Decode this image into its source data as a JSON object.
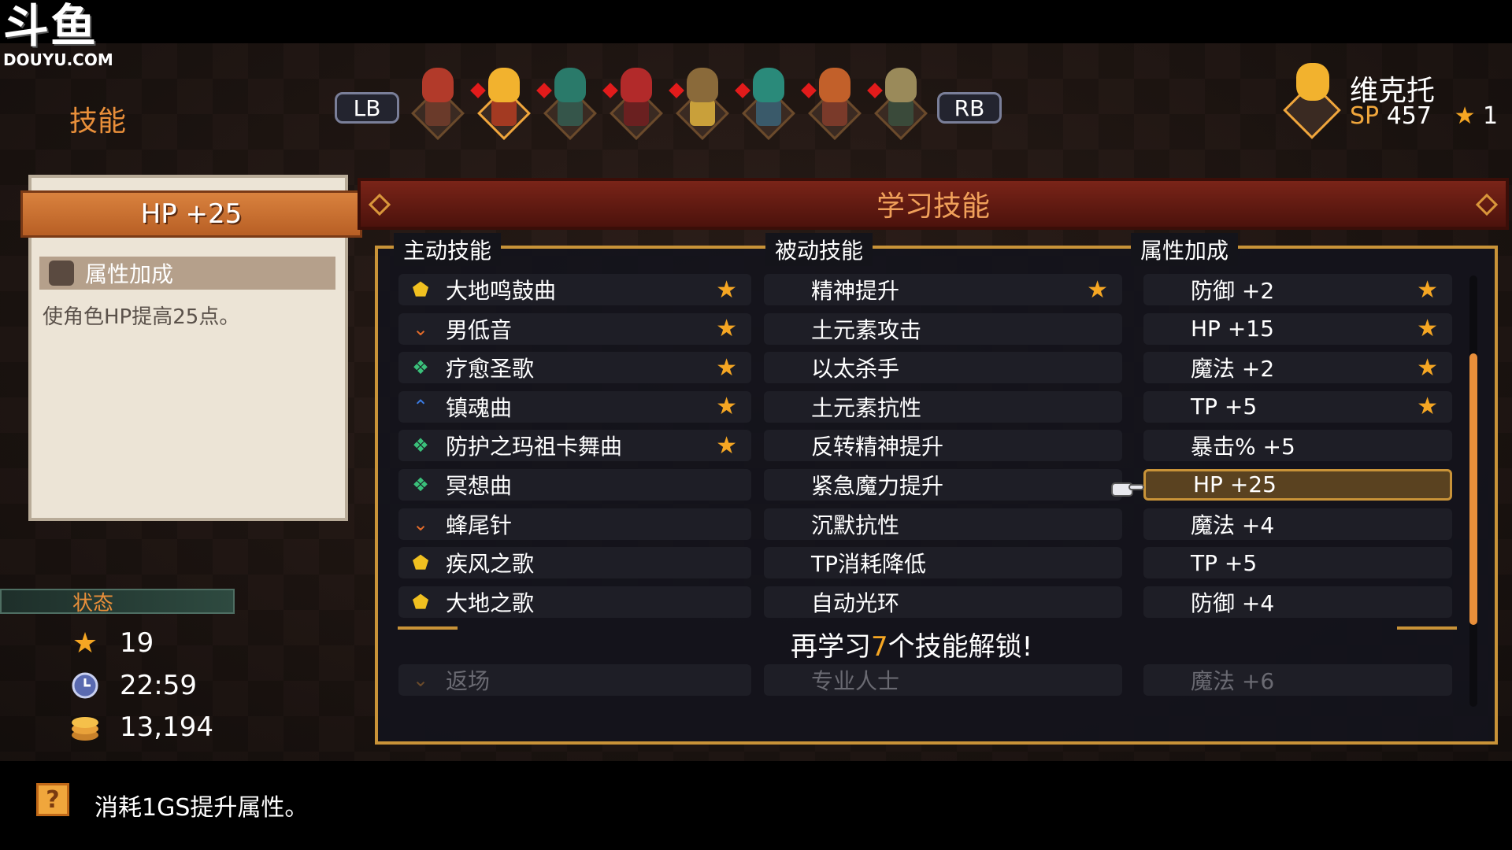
{
  "watermark": {
    "glyph": "斗鱼",
    "text": "DOUYU.COM"
  },
  "screen_title": "技能",
  "bumpers": {
    "left": "LB",
    "right": "RB"
  },
  "party": [
    {
      "head": "#b23a2a",
      "body": "#6a3a2a",
      "dot": false
    },
    {
      "head": "#f2b22e",
      "body": "#a33a22",
      "dot": true,
      "selected": true
    },
    {
      "head": "#2a7a6a",
      "body": "#35554a",
      "dot": true
    },
    {
      "head": "#b22a2a",
      "body": "#6a2020",
      "dot": true
    },
    {
      "head": "#8a6a3a",
      "body": "#c9a03a",
      "dot": true
    },
    {
      "head": "#2a8a7a",
      "body": "#3a5a6a",
      "dot": true
    },
    {
      "head": "#c2602a",
      "body": "#7a3a2a",
      "dot": true
    },
    {
      "head": "#9a8a5a",
      "body": "#3a4a3a",
      "dot": true
    }
  ],
  "character": {
    "name": "维克托",
    "sp_label": "SP",
    "sp_value": "457",
    "star_glyph": "★",
    "star_count": "1"
  },
  "info": {
    "title": "HP +25",
    "category": "属性加成",
    "description": "使角色HP提高25点。"
  },
  "status": {
    "header": "状态",
    "stars": "19",
    "time": "22:59",
    "gold": "13,194"
  },
  "skills_title": "学习技能",
  "columns": {
    "active": "主动技能",
    "passive": "被动技能",
    "attr": "属性加成"
  },
  "active_skills": [
    {
      "name": "大地鸣鼓曲",
      "icon": "yellow-shield-icon",
      "icon_glyph": "⬟",
      "color": "#f0c020",
      "learned": true
    },
    {
      "name": "男低音",
      "icon": "orange-chevron-icon",
      "icon_glyph": "⌄",
      "color": "#e06a2a",
      "learned": true
    },
    {
      "name": "疗愈圣歌",
      "icon": "green-heal-icon",
      "icon_glyph": "❖",
      "color": "#3ac07a",
      "learned": true
    },
    {
      "name": "镇魂曲",
      "icon": "blue-arrow-icon",
      "icon_glyph": "⌃",
      "color": "#3a7ae0",
      "learned": true
    },
    {
      "name": "防护之玛祖卡舞曲",
      "icon": "green-heal-icon",
      "icon_glyph": "❖",
      "color": "#3ac07a",
      "learned": true
    },
    {
      "name": "冥想曲",
      "icon": "green-heal-icon",
      "icon_glyph": "❖",
      "color": "#3ac07a",
      "learned": false
    },
    {
      "name": "蜂尾针",
      "icon": "orange-chevron-icon",
      "icon_glyph": "⌄",
      "color": "#e06a2a",
      "learned": false
    },
    {
      "name": "疾风之歌",
      "icon": "yellow-shield-icon",
      "icon_glyph": "⬟",
      "color": "#f0c020",
      "learned": false
    },
    {
      "name": "大地之歌",
      "icon": "yellow-shield-icon",
      "icon_glyph": "⬟",
      "color": "#f0c020",
      "learned": false
    }
  ],
  "passive_skills": [
    {
      "name": "精神提升",
      "learned": true
    },
    {
      "name": "土元素攻击",
      "learned": false
    },
    {
      "name": "以太杀手",
      "learned": false
    },
    {
      "name": "土元素抗性",
      "learned": false
    },
    {
      "name": "反转精神提升",
      "learned": false
    },
    {
      "name": "紧急魔力提升",
      "learned": false
    },
    {
      "name": "沉默抗性",
      "learned": false
    },
    {
      "name": "TP消耗降低",
      "learned": false
    },
    {
      "name": "自动光环",
      "learned": false
    }
  ],
  "attr_skills": [
    {
      "name": "防御 +2",
      "learned": true
    },
    {
      "name": "HP +15",
      "learned": true
    },
    {
      "name": "魔法 +2",
      "learned": true
    },
    {
      "name": "TP +5",
      "learned": true
    },
    {
      "name": "暴击% +5",
      "learned": false
    },
    {
      "name": "HP +25",
      "learned": false,
      "selected": true
    },
    {
      "name": "魔法 +4",
      "learned": false
    },
    {
      "name": "TP +5",
      "learned": false
    },
    {
      "name": "防御 +4",
      "learned": false
    }
  ],
  "unlock": {
    "prefix": "再学习",
    "count": "7",
    "suffix": "个技能解锁!"
  },
  "locked": {
    "active": "返场",
    "passive": "专业人士",
    "attr": "魔法 +6"
  },
  "star_glyph": "★",
  "scroll_fraction": {
    "thumb_start": 0.18,
    "thumb_size": 0.63
  },
  "footer": {
    "help_glyph": "?",
    "text": "消耗1GS提升属性。"
  },
  "colors": {
    "accent": "#e98f3a",
    "gold_border": "#c99338",
    "star": "#f5a623",
    "banner_red": "#7a2418"
  }
}
